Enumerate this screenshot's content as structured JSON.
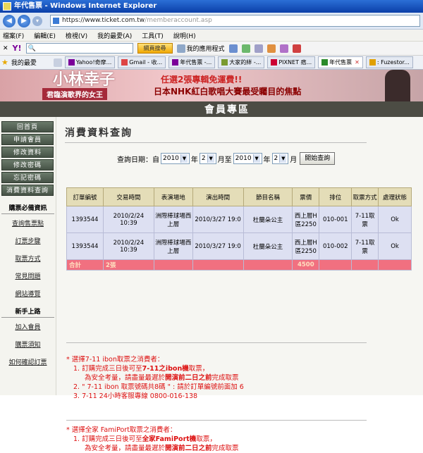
{
  "window": {
    "title": "年代售票 - Windows Internet Explorer"
  },
  "address": {
    "url_main": "https://www.ticket.com.tw",
    "url_rest": "/memberaccount.asp"
  },
  "menu": [
    "檔案(F)",
    "編輯(E)",
    "檢視(V)",
    "我的最愛(A)",
    "工具(T)",
    "說明(H)"
  ],
  "yahoo_bar": {
    "logo": "Y!",
    "search_button": "網頁搜尋",
    "apps_label": "我的應用程式"
  },
  "favorites": {
    "label": "我的最愛"
  },
  "tabs": [
    {
      "label": "Yahoo!奇摩..."
    },
    {
      "label": "Gmail - 收..."
    },
    {
      "label": "年代售票 -..."
    },
    {
      "label": "大家的絆 -..."
    },
    {
      "label": "PIXNET 痞..."
    },
    {
      "label": "年代售票"
    },
    {
      "label": ": Fuzestor..."
    }
  ],
  "banner": {
    "name": "小林幸子",
    "subtitle": "君臨演歌界的女王",
    "line1": "任選2張專輯免運費!!",
    "line2": "日本NHK紅白歌唱大賽最受矚目的焦點",
    "zone": "會員專區"
  },
  "sidebar": {
    "buttons": [
      "回首頁",
      "申請會員",
      "修改資料",
      "修改密碼",
      "忘記密碼",
      "消費資料查詢"
    ],
    "section1": {
      "title": "購票必備資訊",
      "links": [
        "查詢售票點",
        "訂票步驟",
        "取票方式",
        "常見問題",
        "網站導覽"
      ]
    },
    "section2": {
      "title": "新手上路",
      "links": [
        "加入會員",
        "購票須知",
        "如何確認訂票"
      ]
    }
  },
  "main": {
    "title": "消費資料查詢",
    "query": {
      "label": "查詢日期：自",
      "from_year": "2010",
      "from_month": "2",
      "to_year": "2010",
      "to_month": "2",
      "year_word": "年",
      "month_word_to": "月至",
      "month_word": "月",
      "button": "開始查詢"
    },
    "table": {
      "headers": [
        "訂單編號",
        "交易時間",
        "表演場地",
        "演出時間",
        "節目名稱",
        "票價",
        "排位",
        "取票方式",
        "處理狀態"
      ],
      "rows": [
        [
          "1393544",
          "2010/2/24 10:39",
          "洲際棒球場西上層",
          "2010/3/27 19:0",
          "杜蘭朵公主",
          "西上層H區2250",
          "010-001",
          "7-11取票",
          "Ok"
        ],
        [
          "1393544",
          "2010/2/24 10:39",
          "洲際棒球場西上層",
          "2010/3/27 19:0",
          "杜蘭朵公主",
          "西上層H區2250",
          "010-002",
          "7-11取票",
          "Ok"
        ]
      ],
      "total_label": "合計",
      "total_count": "2張",
      "total_amount": "4500"
    },
    "notes": {
      "ibon": {
        "heading": "* 選擇7-11 ibon取票之消費者：",
        "l1a": "1. 訂購完成三日後可至",
        "l1b": "7-11之ibon機",
        "l1c": "取票，",
        "l2a": "為安全考量，請盡量最遲於",
        "l2b": "開演前二日之前",
        "l2c": "完成取票",
        "l3": "2. \" 7-11 ibon 取票號碼共8碼 \" : 請於訂單編號前面加 6",
        "l4": "3. 7-11 24小時客服專線 0800-016-138"
      },
      "famiport": {
        "heading": "* 選擇全家 FamiPort取票之消費者：",
        "l1a": "1. 訂購完成三日後可至",
        "l1b": "全家FamiPort機",
        "l1c": "取票，",
        "l2a": "為安全考量，請盡量最遲於",
        "l2b": "開演前二日之前",
        "l2c": "完成取票"
      }
    }
  }
}
